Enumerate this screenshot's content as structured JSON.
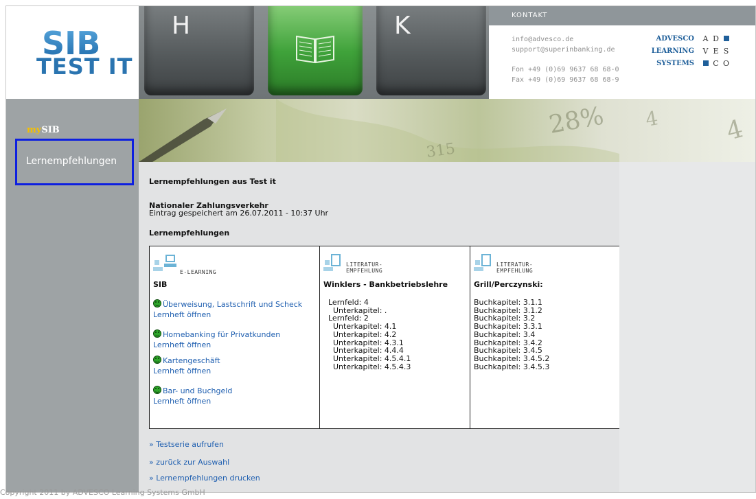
{
  "header": {
    "logo_top": "SIB",
    "logo_bottom": "TEST IT",
    "keys": [
      "H",
      "K"
    ],
    "contact": {
      "title": "KONTAKT",
      "email1": "info@advesco.de",
      "email2": "support@superinbanking.de",
      "phone": "Fon +49 (0)69 9637 68 68-0",
      "fax": "Fax +49 (0)69 9637 68 68-9"
    },
    "advesco": {
      "row1_word": "ADVESCO",
      "row1_letters": [
        "A",
        "D"
      ],
      "row2_word": "LEARNING",
      "row2_letters": [
        "V",
        "E",
        "S"
      ],
      "row3_word": "SYSTEMS",
      "row3_letters": [
        "C",
        "O"
      ]
    }
  },
  "nav": {
    "mysib_prefix": "my",
    "mysib_suffix": "SIB",
    "item_label": "Lernempfehlungen"
  },
  "main": {
    "page_heading": "Lernempfehlungen aus Test it",
    "topic": "Nationaler Zahlungsverkehr",
    "saved_line": "Eintrag gespeichert am 26.07.2011 - 10:37 Uhr",
    "section_heading": "Lernempfehlungen",
    "col1": {
      "type_line1": "E-LEARNING",
      "title": "SIB",
      "courses": [
        {
          "name": "Überweisung, Lastschrift und Scheck",
          "link": "Lernheft öffnen"
        },
        {
          "name": "Homebanking für Privatkunden",
          "link": "Lernheft öffnen"
        },
        {
          "name": "Kartengeschäft",
          "link": "Lernheft öffnen"
        },
        {
          "name": "Bar- und Buchgeld",
          "link": "Lernheft öffnen"
        }
      ]
    },
    "col2": {
      "type_line1": "LITERATUR-",
      "type_line2": "EMPFEHLUNG",
      "title": "Winklers - Bankbetriebslehre",
      "lines": "Lernfeld: 4\n  Unterkapitel: .\nLernfeld: 2\n  Unterkapitel: 4.1\n  Unterkapitel: 4.2\n  Unterkapitel: 4.3.1\n  Unterkapitel: 4.4.4\n  Unterkapitel: 4.5.4.1\n  Unterkapitel: 4.5.4.3"
    },
    "col3": {
      "type_line1": "LITERATUR-",
      "type_line2": "EMPFEHLUNG",
      "title": "Grill/Perczynski:",
      "lines": "Buchkapitel: 3.1.1\nBuchkapitel: 3.1.2\nBuchkapitel: 3.2\nBuchkapitel: 3.3.1\nBuchkapitel: 3.4\nBuchkapitel: 3.4.2\nBuchkapitel: 3.4.5\nBuchkapitel: 3.4.5.2\nBuchkapitel: 3.4.5.3"
    },
    "links": {
      "testserie": "» Testserie aufrufen",
      "zurueck": "» zurück zur Auswahl",
      "drucken": "» Lernempfehlungen drucken"
    }
  },
  "footer": {
    "copyright": "Copyright 2011 by ADVESCO Learning Systems GmbH"
  },
  "colors": {
    "logo_blue": "#2a74b0",
    "nav_gray": "#9ea3a5",
    "highlight_box": "#0d1fe0",
    "link_blue": "#1f5fb0",
    "smiley_green": "#2ea52a"
  }
}
